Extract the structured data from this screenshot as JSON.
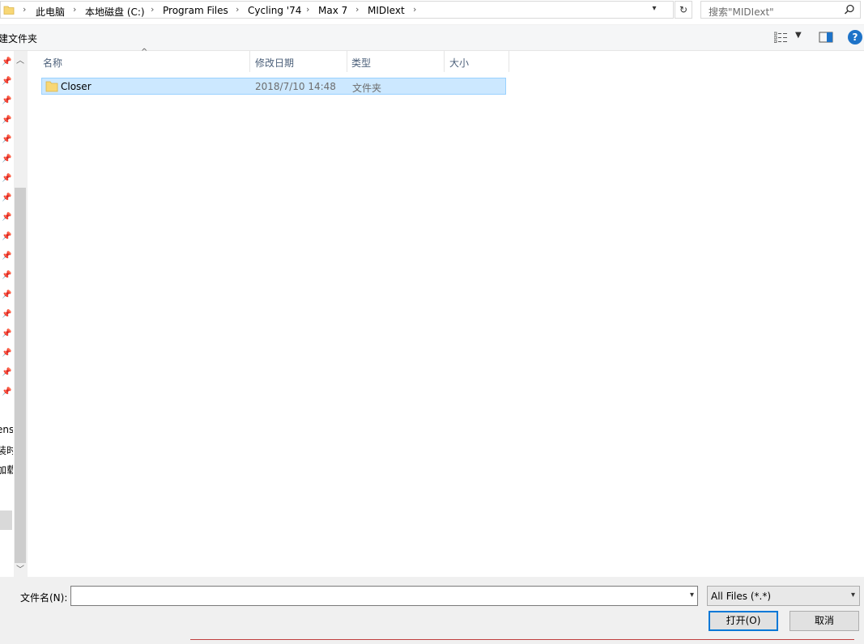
{
  "address_bar": {
    "crumbs": [
      "此电脑",
      "本地磁盘 (C:)",
      "Program Files",
      "Cycling '74",
      "Max 7",
      "MIDIext"
    ]
  },
  "search": {
    "placeholder": "搜索\"MIDIext\""
  },
  "toolbar": {
    "new_folder_label": "建文件夹"
  },
  "nav_pane": {
    "clipped_labels": [
      "ens",
      "装时",
      "加载"
    ]
  },
  "file_list": {
    "columns": [
      "名称",
      "修改日期",
      "类型",
      "大小"
    ],
    "rows": [
      {
        "name": "Closer",
        "modified": "2018/7/10 14:48",
        "type": "文件夹",
        "size": ""
      }
    ]
  },
  "footer": {
    "filename_label": "文件名(N):",
    "filename_value": "",
    "filter_value": "All Files (*.*)",
    "open_label": "打开(O)",
    "cancel_label": "取消"
  },
  "colors": {
    "selection": "#cce8ff",
    "selection_border": "#99d1ff",
    "accent": "#0078d7",
    "folder": "#f8d775"
  }
}
